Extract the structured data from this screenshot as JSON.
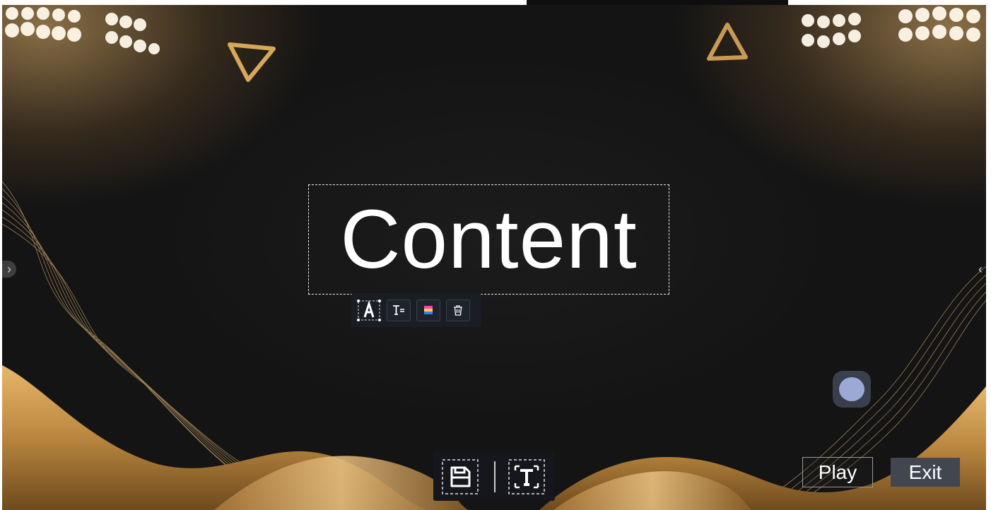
{
  "canvas": {
    "content_text": "Content"
  },
  "text_toolbar": {
    "icons": [
      "font-style-icon",
      "text-format-icon",
      "color-palette-icon",
      "trash-icon"
    ]
  },
  "side_nav": {
    "left_arrow": "›",
    "right_arrow": "‹"
  },
  "bottom_toolbar": {
    "icons": [
      "save-icon",
      "add-text-icon"
    ]
  },
  "actions": {
    "play_label": "Play",
    "exit_label": "Exit"
  },
  "colors": {
    "background": "#141414",
    "gold": "#c99a55",
    "float_ball": "#9ba9d6",
    "exit_bg": "#41464f"
  }
}
